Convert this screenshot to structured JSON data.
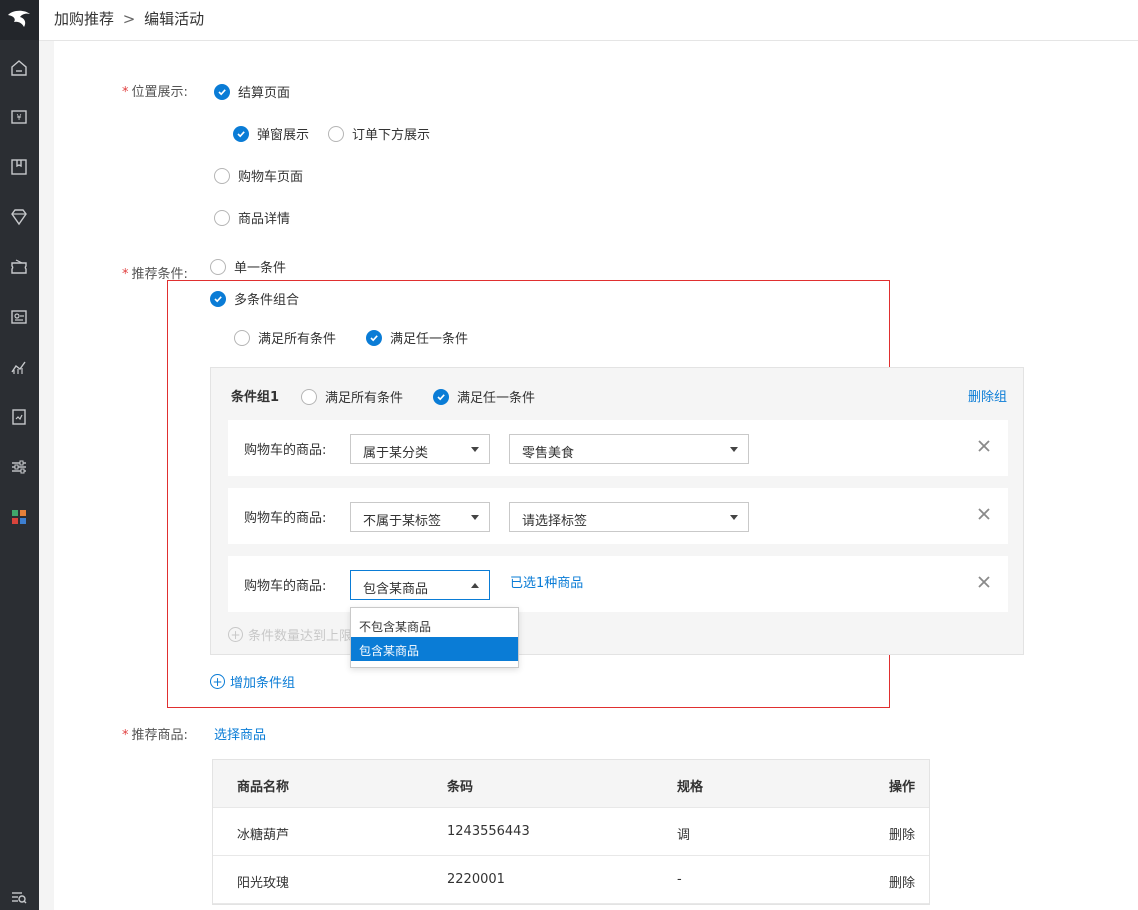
{
  "breadcrumb": {
    "parent": "加购推荐",
    "separator": ">",
    "current": "编辑活动"
  },
  "colors": {
    "accent": "#0a7cd6",
    "required": "#e03e3e",
    "highlight_border": "#e02f2f",
    "sidebar": "#2b2e33"
  },
  "sidebar": {
    "icons": [
      "logo-icon",
      "home-icon",
      "finance-icon",
      "package-icon",
      "diamond-icon",
      "coupon-icon",
      "member-card-icon",
      "analytics-icon",
      "report-icon",
      "settings-sliders-icon",
      "apps-icon",
      "search-list-icon"
    ]
  },
  "position": {
    "label": "位置展示:",
    "checkout_page": "结算页面",
    "popup_display": "弹窗展示",
    "below_order_display": "订单下方展示",
    "cart_page": "购物车页面",
    "product_detail": "商品详情"
  },
  "condition": {
    "label": "推荐条件:",
    "single": "单一条件",
    "multi": "多条件组合",
    "match_all": "满足所有条件",
    "match_any": "满足任一条件"
  },
  "group": {
    "title": "条件组1",
    "match_all": "满足所有条件",
    "match_any": "满足任一条件",
    "delete_label": "删除组",
    "rows": [
      {
        "label": "购物车的商品:",
        "operator": "属于某分类",
        "value": "零售美食"
      },
      {
        "label": "购物车的商品:",
        "operator": "不属于某标签",
        "value": "请选择标签"
      },
      {
        "label": "购物车的商品:",
        "operator": "包含某商品",
        "selected_text": "已选1种商品"
      }
    ],
    "limit_text": "条件数量达到上限"
  },
  "dropdown": {
    "options": [
      "不包含某商品",
      "包含某商品"
    ],
    "selected": "包含某商品"
  },
  "add_group_label": "增加条件组",
  "products": {
    "label": "推荐商品:",
    "select_label": "选择商品",
    "columns": [
      "商品名称",
      "条码",
      "规格",
      "操作"
    ],
    "rows": [
      {
        "name": "冰糖葫芦",
        "barcode": "1243556443",
        "spec": "调",
        "action": "删除"
      },
      {
        "name": "阳光玫瑰",
        "barcode": "2220001",
        "spec": "-",
        "action": "删除"
      }
    ]
  }
}
